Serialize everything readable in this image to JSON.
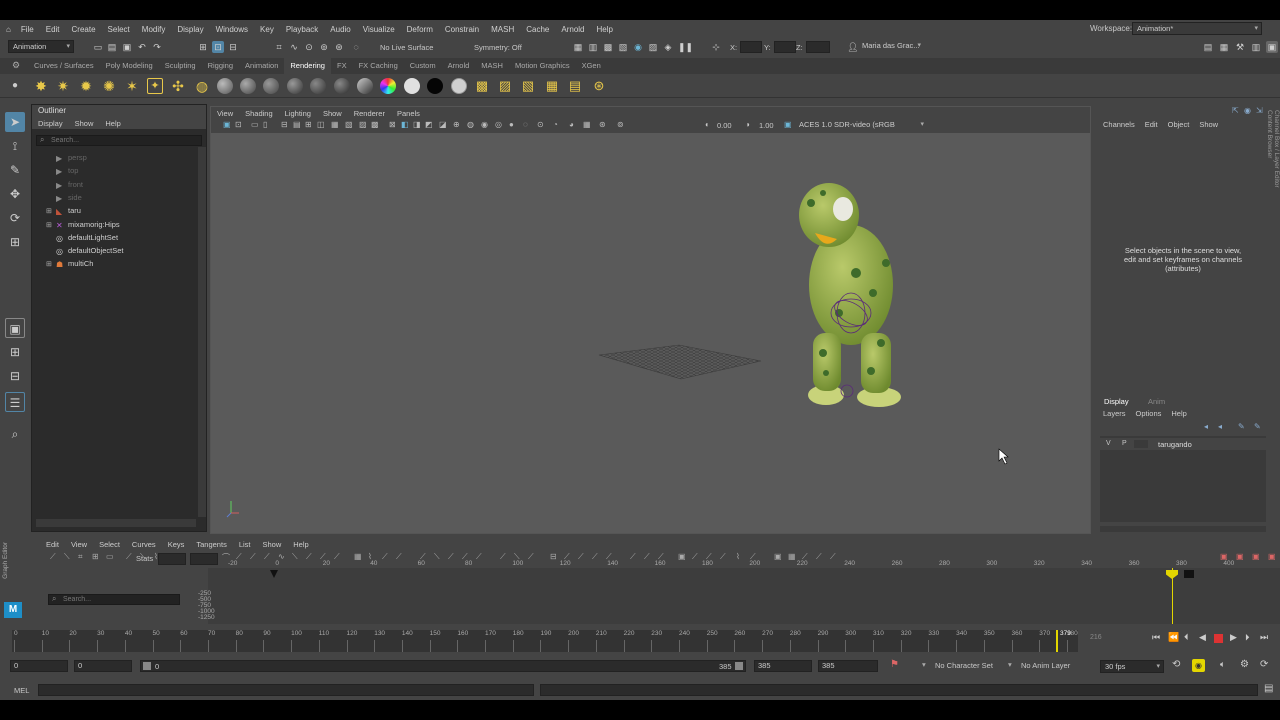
{
  "menubar": {
    "items": [
      "File",
      "Edit",
      "Create",
      "Select",
      "Modify",
      "Display",
      "Windows",
      "Key",
      "Playback",
      "Audio",
      "Visualize",
      "Deform",
      "Constrain",
      "MASH",
      "Cache",
      "Arnold",
      "Help"
    ],
    "workspace_label": "Workspace:",
    "workspace_value": "Animation*"
  },
  "statusline": {
    "mode_menu": "Animation",
    "live_surface": "No Live Surface",
    "symmetry": "Symmetry: Off",
    "x_label": "X:",
    "y_label": "Y:",
    "z_label": "Z:",
    "user": "Maria das Grac..."
  },
  "shelf": {
    "tabs": [
      "Curves / Surfaces",
      "Poly Modeling",
      "Sculpting",
      "Rigging",
      "Animation",
      "Rendering",
      "FX",
      "FX Caching",
      "Custom",
      "Arnold",
      "MASH",
      "Motion Graphics",
      "XGen"
    ],
    "active_tab": "Rendering"
  },
  "outliner": {
    "title": "Outliner",
    "menu": [
      "Display",
      "Show",
      "Help"
    ],
    "search_placeholder": "Search...",
    "items": [
      {
        "label": "persp",
        "dim": true,
        "expand": false,
        "icon": "camera-icon"
      },
      {
        "label": "top",
        "dim": true,
        "expand": false,
        "icon": "camera-icon"
      },
      {
        "label": "front",
        "dim": true,
        "expand": false,
        "icon": "camera-icon"
      },
      {
        "label": "side",
        "dim": true,
        "expand": false,
        "icon": "camera-icon"
      },
      {
        "label": "taru",
        "dim": false,
        "expand": true,
        "icon": "mesh-icon"
      },
      {
        "label": "mixamorig:Hips",
        "dim": false,
        "expand": true,
        "icon": "joint-icon"
      },
      {
        "label": "defaultLightSet",
        "dim": false,
        "expand": false,
        "icon": "set-icon"
      },
      {
        "label": "defaultObjectSet",
        "dim": false,
        "expand": false,
        "icon": "set-icon"
      },
      {
        "label": "multiCh",
        "dim": false,
        "expand": true,
        "icon": "character-icon"
      }
    ]
  },
  "viewport": {
    "menu": [
      "View",
      "Shading",
      "Lighting",
      "Show",
      "Renderer",
      "Panels"
    ],
    "exposure": "0.00",
    "gamma": "1.00",
    "color_space": "ACES 1.0 SDR-video (sRGB"
  },
  "channelbox": {
    "menu": [
      "Channels",
      "Edit",
      "Object",
      "Show"
    ],
    "empty_message": "Select objects in the scene to view, edit and set keyframes on channels (attributes)",
    "side_tab_1": "Channel Box / Layer Editor",
    "side_tab_2": "Content Browser"
  },
  "layers": {
    "tabs": [
      "Display",
      "Anim"
    ],
    "menu": [
      "Layers",
      "Options",
      "Help"
    ],
    "layer": {
      "v": "V",
      "p": "P",
      "name": "tarugando"
    }
  },
  "graph_editor": {
    "side_label": "Graph Editor",
    "menu": [
      "Edit",
      "View",
      "Select",
      "Curves",
      "Keys",
      "Tangents",
      "List",
      "Show",
      "Help"
    ],
    "stats_label": "Stats",
    "search_placeholder": "Search...",
    "ruler": [
      "-20",
      "0",
      "20",
      "40",
      "60",
      "80",
      "100",
      "120",
      "140",
      "160",
      "180",
      "200",
      "220",
      "240",
      "260",
      "280",
      "300",
      "320",
      "340",
      "360",
      "380",
      "400"
    ],
    "vlabels": [
      "-250",
      "-500",
      "-750",
      "-1000",
      "-1250"
    ]
  },
  "time_slider": {
    "ticks": [
      "0",
      "10",
      "20",
      "30",
      "40",
      "50",
      "60",
      "70",
      "80",
      "90",
      "100",
      "110",
      "120",
      "130",
      "140",
      "150",
      "160",
      "170",
      "180",
      "190",
      "200",
      "210",
      "220",
      "230",
      "240",
      "250",
      "260",
      "270",
      "280",
      "290",
      "300",
      "310",
      "320",
      "330",
      "340",
      "350",
      "360",
      "370",
      "380"
    ],
    "current_frame": "379",
    "current_field": "216"
  },
  "range": {
    "start": "0",
    "anim_start": "0",
    "slider_start": "0",
    "slider_end": "385",
    "anim_end": "385",
    "end": "385",
    "character_set": "No Character Set",
    "anim_layer": "No Anim Layer",
    "fps": "30 fps"
  },
  "cmdline": {
    "label": "MEL"
  },
  "colors": {
    "bg": "#444444",
    "field": "#2b2b2b",
    "viewport": "#5a5a5a",
    "active": "#5285a6",
    "playhead": "#e3d600"
  }
}
